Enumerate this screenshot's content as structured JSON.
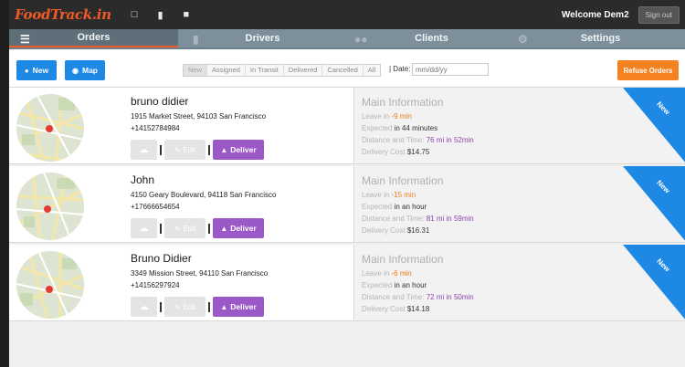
{
  "app": {
    "logo": "FoodTrack.in",
    "welcome": "Welcome Dem2",
    "signout_label": "Sign out"
  },
  "nav": {
    "tabs": [
      {
        "label": "Orders",
        "icon": "list-icon",
        "active": true
      },
      {
        "label": "Drivers",
        "icon": "phone-icon",
        "active": false
      },
      {
        "label": "Clients",
        "icon": "users-icon",
        "active": false
      },
      {
        "label": "Settings",
        "icon": "gear-icon",
        "active": false
      }
    ]
  },
  "toolbar": {
    "new_label": "New",
    "map_label": "Map",
    "filters": [
      "New",
      "Assigned",
      "In Transit",
      "Delivered",
      "Cancelled",
      "All"
    ],
    "active_filter": "New",
    "date_label": "| Date:",
    "date_placeholder": "mm/dd/yy",
    "refuse_label": "Refuse Orders"
  },
  "colors": {
    "accent_orange": "#f05a28",
    "primary_blue": "#1e88e5",
    "deliver_purple": "#9b59c8",
    "refuse_orange": "#f58220"
  },
  "orders": [
    {
      "name": "bruno didier",
      "address": "1915 Market Street, 94103 San Francisco",
      "phone": "+14152784984",
      "edit_label": "Edit",
      "deliver_label": "Deliver",
      "info_title": "Main Information",
      "leave_label": "Leave in",
      "leave_value": "-9 min",
      "expected_label": "Expected",
      "expected_value": "in 44 minutes",
      "distance_label": "Distance and Time:",
      "distance_value": "76 mi in 52min",
      "cost_label": "Delivery Cost",
      "cost_value": "$14.75",
      "badge": "New"
    },
    {
      "name": "John",
      "address": "4150 Geary Boulevard, 94118 San Francisco",
      "phone": "+17666654654",
      "edit_label": "Edit",
      "deliver_label": "Deliver",
      "info_title": "Main Information",
      "leave_label": "Leave in",
      "leave_value": "-15 min",
      "expected_label": "Expected",
      "expected_value": "in an hour",
      "distance_label": "Distance and Time:",
      "distance_value": "81 mi in 59min",
      "cost_label": "Delivery Cost",
      "cost_value": "$16.31",
      "badge": "New"
    },
    {
      "name": "Bruno Didier",
      "address": "3349 Mission Street, 94110 San Francisco",
      "phone": "+14156297924",
      "edit_label": "Edit",
      "deliver_label": "Deliver",
      "info_title": "Main Information",
      "leave_label": "Leave in",
      "leave_value": "-6 min",
      "expected_label": "Expected",
      "expected_value": "in an hour",
      "distance_label": "Distance and Time:",
      "distance_value": "72 mi in 50min",
      "cost_label": "Delivery Cost",
      "cost_value": "$14.18",
      "badge": "New"
    }
  ]
}
